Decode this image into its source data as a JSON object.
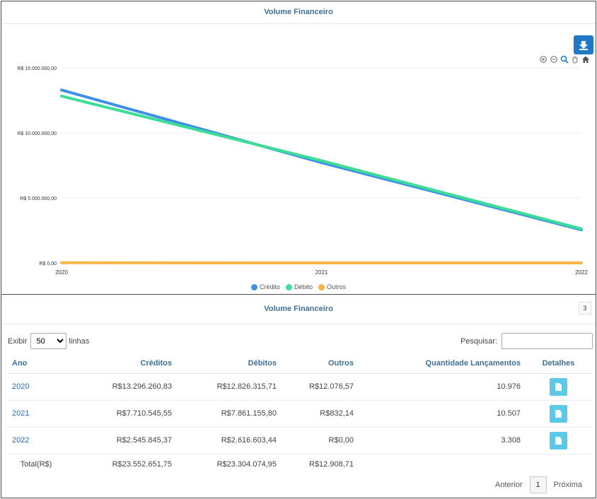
{
  "chart_panel": {
    "title": "Volume Financeiro"
  },
  "chart_data": {
    "type": "line",
    "title": "Volume Financeiro",
    "x": [
      "2020",
      "2021",
      "2022"
    ],
    "y_ticks": [
      "R$ 0,00",
      "R$ 5.000.000,00",
      "R$ 10.000.000,00",
      "R$ 15.000.000,00"
    ],
    "ylim": [
      0,
      15000000
    ],
    "grid": true,
    "legend_position": "bottom",
    "series": [
      {
        "name": "Crédito",
        "color": "#3d8fe8",
        "values": [
          13296260.83,
          7710545.55,
          2545845.37
        ]
      },
      {
        "name": "Débito",
        "color": "#3ddc97",
        "values": [
          12826315.71,
          7861155.8,
          2616603.44
        ]
      },
      {
        "name": "Outros",
        "color": "#f7b547",
        "values": [
          12076.57,
          832.14,
          0
        ]
      }
    ]
  },
  "toolbar": {
    "download_icon": "download-icon",
    "icons": [
      "zoom-in-icon",
      "zoom-out-icon",
      "zoom-select-icon",
      "pan-icon",
      "reset-home-icon"
    ]
  },
  "table_panel": {
    "title": "Volume Financeiro",
    "count_badge": "3",
    "show_label": "Exibir",
    "show_value": "50",
    "show_options": [
      "50"
    ],
    "lines_label": "linhas",
    "search_label": "Pesquisar:",
    "search_value": "",
    "columns": [
      "Ano",
      "Créditos",
      "Débitos",
      "Outros",
      "Quantidade Lançamentos",
      "Detalhes"
    ],
    "rows": [
      {
        "ano": "2020",
        "creditos": "R$13.296.260,83",
        "debitos": "R$12.826.315,71",
        "outros": "R$12.076,57",
        "quantidade": "10.976"
      },
      {
        "ano": "2021",
        "creditos": "R$7.710.545,55",
        "debitos": "R$7.861.155,80",
        "outros": "R$832,14",
        "quantidade": "10.507"
      },
      {
        "ano": "2022",
        "creditos": "R$2.545.845,37",
        "debitos": "R$2.616.603,44",
        "outros": "R$0,00",
        "quantidade": "3.308"
      }
    ],
    "total": {
      "label": "Total(R$)",
      "creditos": "R$23.552.651,75",
      "debitos": "R$23.304.074,95",
      "outros": "R$12.908,71"
    },
    "pagination": {
      "previous": "Anterior",
      "page": "1",
      "next": "Próxima"
    }
  }
}
